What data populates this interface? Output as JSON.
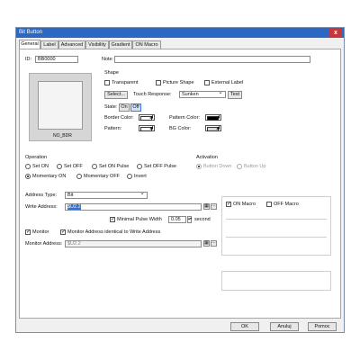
{
  "window": {
    "title": "Bit Button",
    "close_glyph": "x"
  },
  "tabs": [
    "General",
    "Label",
    "Advanced",
    "Visibility",
    "Gradient",
    "ON Macro"
  ],
  "general": {
    "id_label": "ID:",
    "id_value": "BB0000",
    "note_label": "Note:",
    "note_value": "",
    "preview_caption": "NO_BDR",
    "shape": {
      "title": "Shape",
      "transparent": "Transparent",
      "picture_shape": "Picture Shape",
      "external_label": "External Label",
      "select_button": "Select...",
      "touch_response_label": "Touch Response:",
      "touch_response_value": "Sunken",
      "test_button": "Test",
      "state_label": "State:",
      "state_on": "On",
      "state_off": "Off",
      "border_color_label": "Border Color:",
      "pattern_color_label": "Pattern Color:",
      "pattern_label": "Pattern:",
      "bg_color_label": "BG Color:"
    },
    "operation": {
      "title": "Operation",
      "options": [
        "Set ON",
        "Set OFF",
        "Set ON Pulse",
        "Set OFF Pulse",
        "Momentary ON",
        "Momentary OFF",
        "Invert"
      ],
      "selected": "Momentary ON"
    },
    "activation": {
      "title": "Activation",
      "options": [
        "Button Down",
        "Button Up"
      ]
    },
    "address_type_label": "Address Type:",
    "address_type_value": "Bit",
    "write_address_label": "Write Address:",
    "write_address_value": "$U2.2",
    "minimal_pulse_label": "Minimal Pulse Width",
    "minimal_pulse_value": "0.05",
    "pulse_unit": "second",
    "monitor_label": "Monitor",
    "monitor_identical_label": "Monitor Address identical to Write Address",
    "monitor_address_label": "Monitor Address:",
    "monitor_address_value": "$U2.2",
    "on_macro_label": "ON Macro",
    "off_macro_label": "OFF Macro"
  },
  "footer": {
    "ok": "OK",
    "cancel": "Anuluj",
    "help": "Pomoc"
  },
  "colors": {
    "title_bar": "#2b67c3",
    "close_button": "#c8383a",
    "selection": "#2f6fd6"
  }
}
